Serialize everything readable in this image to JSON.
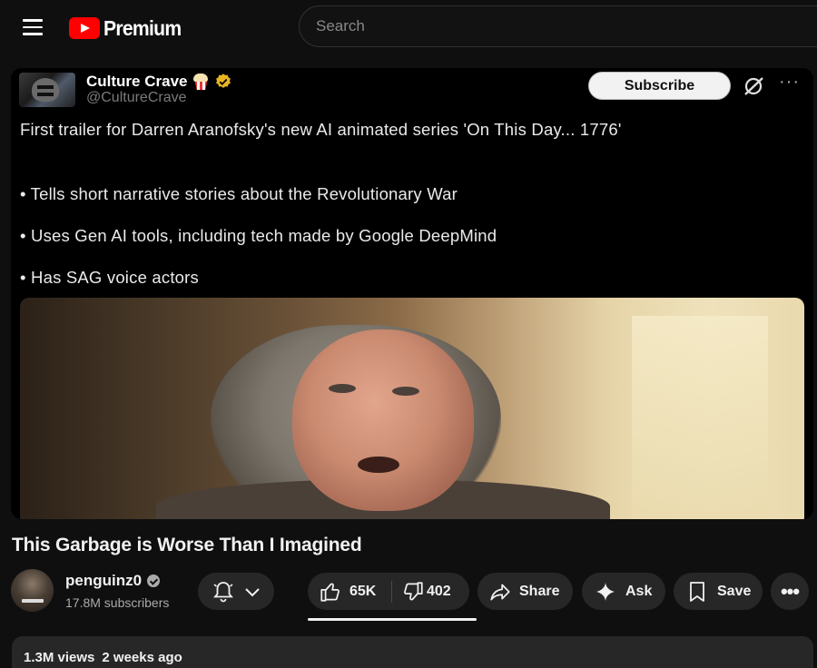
{
  "masthead": {
    "logo_text": "Premium",
    "search_placeholder": "Search"
  },
  "tweet": {
    "display_name": "Culture Crave",
    "handle": "@CultureCrave",
    "subscribe_label": "Subscribe",
    "text": "First trailer for Darren Aranofsky's new AI animated series 'On This Day... 1776'",
    "bullets": [
      "• Tells short narrative stories about the Revolutionary War",
      "• Uses Gen AI tools, including tech made by Google DeepMind",
      "• Has SAG voice actors"
    ]
  },
  "video": {
    "title": "This Garbage is Worse Than I Imagined"
  },
  "channel": {
    "name": "penguinz0",
    "subscribers": "17.8M subscribers"
  },
  "actions": {
    "likes": "65K",
    "dislikes": "402",
    "share": "Share",
    "ask": "Ask",
    "save": "Save",
    "more": "•••"
  },
  "description": {
    "views": "1.3M views",
    "date": "2 weeks ago"
  },
  "colors": {
    "brand_red": "#ff0000",
    "background": "#0f0f0f",
    "pill": "#272727",
    "verified_gold": "#e8b523"
  }
}
